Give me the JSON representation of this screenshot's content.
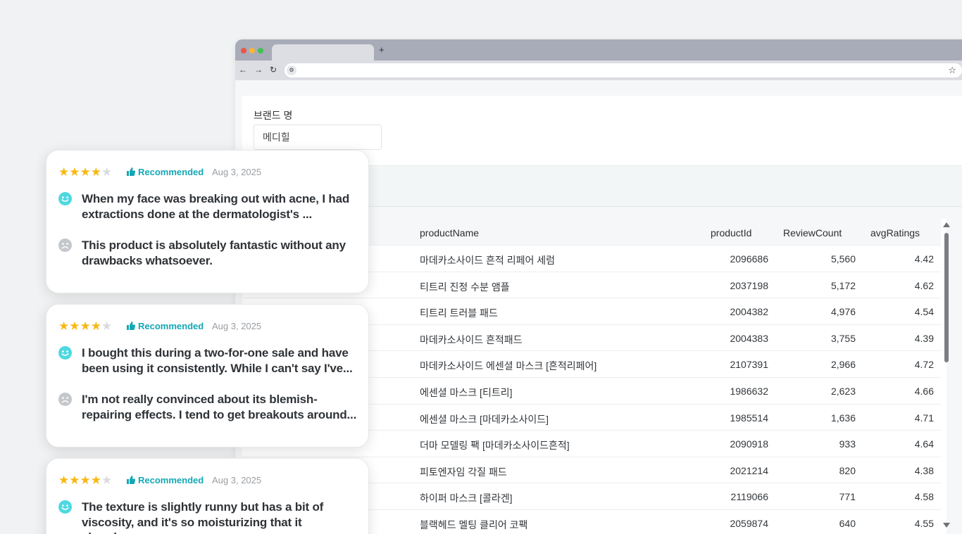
{
  "browser": {
    "new_tab_glyph": "+",
    "nav": {
      "back": "←",
      "forward": "→",
      "reload": "↻"
    },
    "bookmark_glyph": "☆"
  },
  "filter": {
    "label": "브랜드 명",
    "value": "메디힐"
  },
  "table": {
    "columns": [
      "productName",
      "productId",
      "ReviewCount",
      "avgRatings"
    ],
    "rows": [
      [
        "마데카소사이드 흔적 리페어 세럼",
        "2096686",
        "5,560",
        "4.42"
      ],
      [
        "티트리 진정 수분 앰플",
        "2037198",
        "5,172",
        "4.62"
      ],
      [
        "티트리 트러블 패드",
        "2004382",
        "4,976",
        "4.54"
      ],
      [
        "마데카소사이드 흔적패드",
        "2004383",
        "3,755",
        "4.39"
      ],
      [
        "마데카소사이드 에센셜 마스크 [흔적리페어]",
        "2107391",
        "2,966",
        "4.72"
      ],
      [
        "에센셜 마스크 [티트리]",
        "1986632",
        "2,623",
        "4.66"
      ],
      [
        "에센셜 마스크 [마데카소사이드]",
        "1985514",
        "1,636",
        "4.71"
      ],
      [
        "더마 모델링 팩 [마데카소사이드흔적]",
        "2090918",
        "933",
        "4.64"
      ],
      [
        "피토엔자임 각질 패드",
        "2021214",
        "820",
        "4.38"
      ],
      [
        "하이퍼 마스크 [콜라겐]",
        "2119066",
        "771",
        "4.58"
      ],
      [
        "블랙헤드 멜팅 클리어 코팩",
        "2059874",
        "640",
        "4.55"
      ]
    ]
  },
  "reviews": [
    {
      "rating": 4,
      "max_rating": 5,
      "recommended_label": "Recommended",
      "date": "Aug 3, 2025",
      "positive": "When my face was breaking out with acne, I had extractions done at the dermatologist's ...",
      "negative": "This product is absolutely fantastic without any drawbacks whatsoever."
    },
    {
      "rating": 4,
      "max_rating": 5,
      "recommended_label": "Recommended",
      "date": "Aug 3, 2025",
      "positive": "I bought this during a two-for-one sale and have been using it consistently. While I can't say I've...",
      "negative": "I'm not really convinced about its blemish-repairing effects. I tend to get breakouts around..."
    },
    {
      "rating": 4,
      "max_rating": 5,
      "recommended_label": "Recommended",
      "date": "Aug 3, 2025",
      "positive": "The texture is slightly runny but has a bit of viscosity, and it's so moisturizing that it absorbs..."
    }
  ],
  "colors": {
    "star_filled": "#f7b813",
    "star_empty": "#d9dbde",
    "recommended": "#14a7b4",
    "happy_face": "#4fd8e0",
    "sad_face": "#c4c7cb"
  },
  "icons": {
    "thumb": "thumbs-up-icon",
    "positive": "smiley-face-icon",
    "negative": "sad-face-icon",
    "star": "star-icon"
  }
}
